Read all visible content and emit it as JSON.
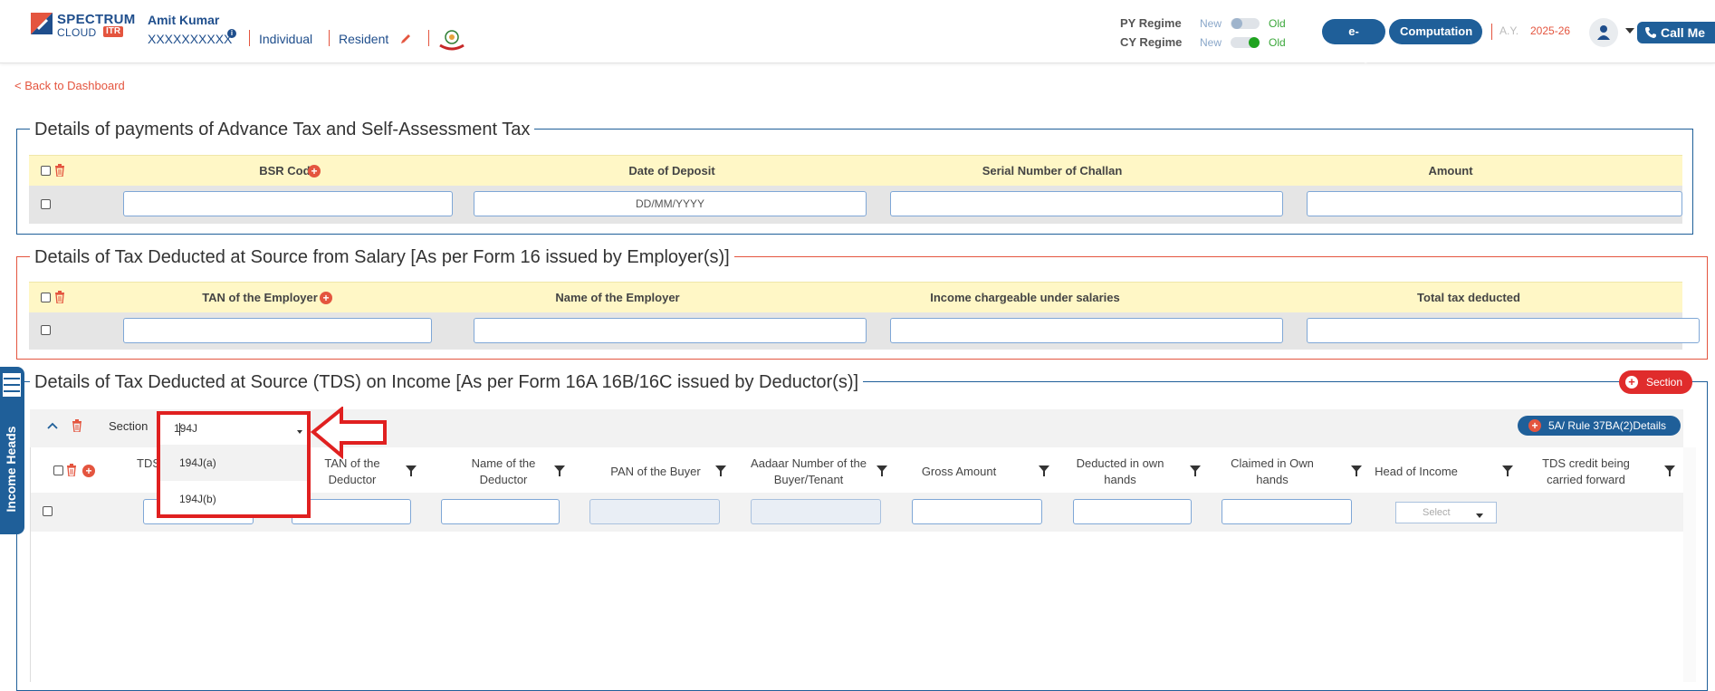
{
  "header": {
    "logo_line1": "SPECTRUM",
    "logo_line2": "CLOUD",
    "logo_badge": "ITR",
    "user_name": "Amit Kumar",
    "user_pan": "XXXXXXXXXX",
    "status_individual": "Individual",
    "status_resident": "Resident",
    "py_regime_label": "PY Regime",
    "cy_regime_label": "CY Regime",
    "regime_new": "New",
    "regime_old": "Old",
    "btn_efiling": "e-Filing",
    "btn_computation": "Computation",
    "ay_label": "A.Y.",
    "ay_value": "2025-26",
    "call_me": "Call Me"
  },
  "back_link": "< Back to Dashboard",
  "advance_tax": {
    "title": "Details of payments of Advance Tax and Self-Assessment Tax",
    "columns": [
      "BSR Code",
      "Date of Deposit",
      "Serial Number of Challan",
      "Amount"
    ],
    "date_placeholder": "DD/MM/YYYY"
  },
  "tds_salary": {
    "title": "Details of Tax Deducted at Source from Salary [As per Form 16 issued by Employer(s)]",
    "columns": [
      "TAN of the Employer",
      "Name of the Employer",
      "Income chargeable under salaries",
      "Total tax deducted"
    ]
  },
  "tds_income": {
    "title": "Details of Tax Deducted at Source (TDS) on Income [As per Form 16A 16B/16C issued by Deductor(s)]",
    "section_button": "Section",
    "section_label": "Section",
    "section_value": "194J",
    "rule_button": "5A/ Rule 37BA(2)Details",
    "dropdown_options": [
      "194J(a)",
      "194J(b)"
    ],
    "columns": [
      "TDS",
      "TAN of the Deductor",
      "Name of the Deductor",
      "PAN of the Buyer",
      "Aadaar Number of the Buyer/Tenant",
      "Gross Amount",
      "Deducted in own hands",
      "Claimed in Own hands",
      "Head of Income",
      "TDS credit being carried forward"
    ],
    "head_select_placeholder": "Select"
  },
  "side_tab": "Income Heads",
  "colors": {
    "primary": "#1f5f99",
    "accent": "#e4553f",
    "header_yellow": "#fff7c6",
    "dropdown_highlight": "#e02020"
  }
}
